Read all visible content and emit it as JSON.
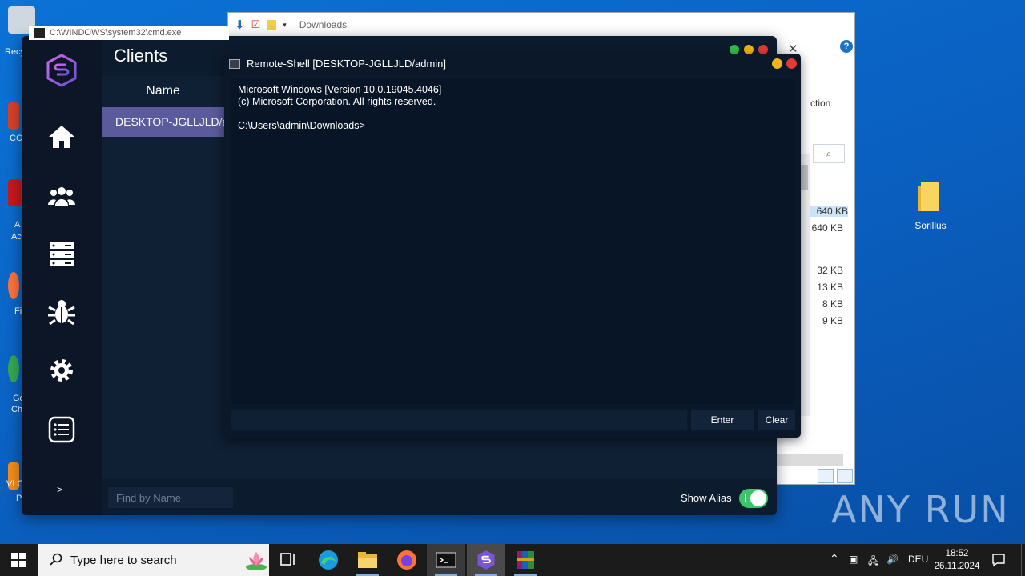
{
  "desktop": {
    "left_labels": [
      "Recy",
      "CC",
      "A",
      "Ac",
      "Fi",
      "Go",
      "Ch",
      "VLC",
      "P"
    ],
    "folder_label": "Sorillus"
  },
  "explorer": {
    "address": "Downloads",
    "ribbon_text": "ction",
    "sizes": [
      "640 KB",
      "640 KB",
      "32 KB",
      "13 KB",
      "8 KB",
      "9 KB"
    ]
  },
  "cmd_behind": {
    "title": "C:\\WINDOWS\\system32\\cmd.exe"
  },
  "app": {
    "title": "Clients",
    "column_header": "Name",
    "client_row": "DESKTOP-JGLLJLD/a...",
    "more_label": ">",
    "find_placeholder": "Find by Name",
    "show_alias_label": "Show Alias",
    "show_alias": true
  },
  "shell": {
    "title": "Remote-Shell [DESKTOP-JGLLJLD/admin]",
    "output": "Microsoft Windows [Version 10.0.19045.4046]\n(c) Microsoft Corporation. All rights reserved.\n\nC:\\Users\\admin\\Downloads>",
    "input_value": "",
    "enter_label": "Enter",
    "clear_label": "Clear"
  },
  "watermark": "ANY RUN",
  "taskbar": {
    "search_placeholder": "Type here to search",
    "language": "DEU",
    "time": "18:52",
    "date": "26.11.2024"
  },
  "colors": {
    "accent_purple": "#5a5a9c",
    "toggle_green": "#3cc46a",
    "dot_green": "#2fbf4b",
    "dot_yellow": "#f2b41a",
    "dot_red": "#e53935"
  }
}
